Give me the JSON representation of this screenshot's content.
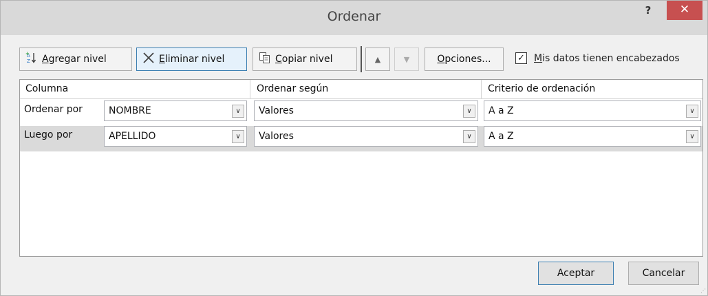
{
  "window": {
    "title": "Ordenar",
    "help_label": "?",
    "close_label": "✕"
  },
  "toolbar": {
    "add_level": {
      "accel": "A",
      "rest": "gregar nivel"
    },
    "delete_level": {
      "accel": "E",
      "rest": "liminar nivel"
    },
    "copy_level": {
      "accel": "C",
      "rest": "opiar nivel"
    },
    "move_up_label": "▲",
    "move_down_label": "▼",
    "options": {
      "accel": "O",
      "rest": "pciones..."
    },
    "headers_checkbox": {
      "accel": "M",
      "rest": "is datos tienen encabezados",
      "checked": true,
      "mark": "✓"
    }
  },
  "grid": {
    "columns": [
      "Columna",
      "Ordenar según",
      "Criterio de ordenación"
    ],
    "rows": [
      {
        "label": "Ordenar por",
        "column": "NOMBRE",
        "sort_on": "Valores",
        "order": "A a Z"
      },
      {
        "label": "Luego por",
        "column": "APELLIDO",
        "sort_on": "Valores",
        "order": "A a Z"
      }
    ]
  },
  "buttons": {
    "ok": "Aceptar",
    "cancel": "Cancelar"
  },
  "icons": {
    "add": "sort-add-icon",
    "delete": "delete-x-icon",
    "copy": "copy-icon",
    "dropdown": "chevron-down-icon"
  },
  "colors": {
    "close_button": "#c75050",
    "titlebar": "#d9d9d9",
    "selected_row": "#dadada",
    "active_button_border": "#3c7fb1"
  }
}
